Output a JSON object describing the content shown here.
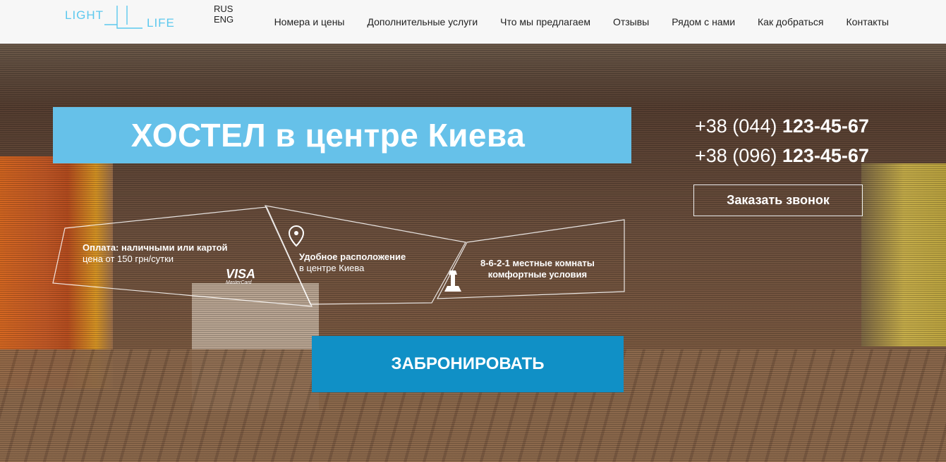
{
  "header": {
    "logo": {
      "word1": "LIGHT",
      "word2": "LIFE"
    },
    "languages": [
      "RUS",
      "ENG"
    ],
    "nav": [
      "Номера и цены",
      "Дополнительные услуги",
      "Что мы предлагаем",
      "Отзывы",
      "Рядом с нами",
      "Как добраться",
      "Контакты"
    ]
  },
  "hero": {
    "title": "ХОСТЕЛ в центре Киева",
    "phones": [
      {
        "prefix": "+38 (044) ",
        "number": "123-45-67"
      },
      {
        "prefix": "+38 (096) ",
        "number": "123-45-67"
      }
    ],
    "callback_label": "Заказать звонок",
    "features": {
      "payment": {
        "line1": "Оплата: наличными или картой",
        "line2": "цена от 150 грн/сутки",
        "card1": "VISA",
        "card2": "MasterCard"
      },
      "location": {
        "line1": "Удобное расположение",
        "line2": "в центре Киева"
      },
      "rooms": {
        "line1": "8-6-2-1 местные комнаты",
        "line2": "комфортные условия"
      }
    },
    "book_label": "ЗАБРОНИРОВАТЬ"
  },
  "colors": {
    "accent": "#66c1e9",
    "button": "#1090c6",
    "logo": "#5cc8ee"
  }
}
